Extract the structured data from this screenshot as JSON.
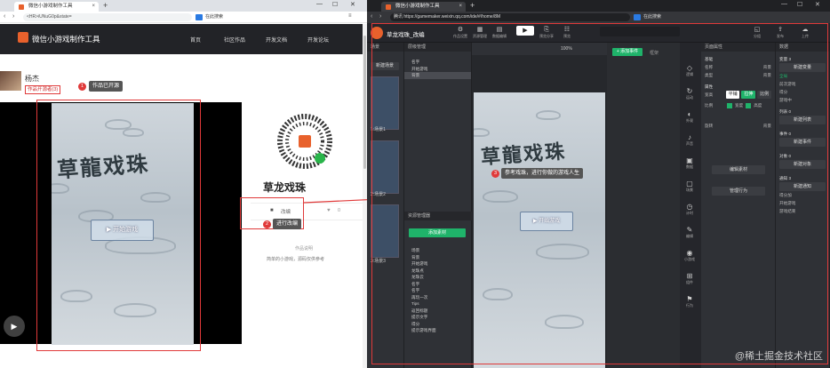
{
  "left_browser": {
    "tab_title": "微信小游戏制作工具",
    "url": "<HR>iUNuG0p&state=",
    "search_text": "在此搜索",
    "site_title": "微信小游戏制作工具",
    "menu": [
      "首页",
      "社区作品",
      "开发文档",
      "开发论坛"
    ],
    "author_name": "杨杰",
    "author_tag": "作品开源者(3)",
    "callout_1": "作品已开源",
    "callout_1_num": "1",
    "game_title": "草龍戏珠",
    "start_label": "▶ 开始游戏",
    "game_name": "草龙戏珠",
    "stat_left": "改编",
    "stat_right": "0",
    "callout_2": "进行改编",
    "callout_2_num": "2",
    "sub_title": "作品说明",
    "sub_desc": "简单的小游戏，源码仅供参考"
  },
  "right_browser": {
    "tab_title": "微信小游戏制作工具",
    "url": "腾讯  https://gamemaker.weixin.qq.com/ide/#/home/8M",
    "search_text": "在此搜索",
    "project_name": "草龙戏珠_改编",
    "toolbar": [
      "作品设置",
      "资源管理",
      "数据编辑",
      "",
      "预览分享",
      "预览",
      "帮助"
    ],
    "toolbar_right": [
      "分组",
      "发布",
      "上传"
    ],
    "left_panel_header": "场景",
    "new_scene": "新建场景",
    "scenes": [
      "1:场景1",
      "2:场景2",
      "3:场景3"
    ],
    "tree_header": "层级管理",
    "tree_items": [
      "名字",
      "开始游戏",
      "背景"
    ],
    "resource_header": "资源管理器",
    "add_resource": "添加素材",
    "resource_items": [
      "场景",
      "背景",
      "开始游戏",
      "龙珠点",
      "龙珠云",
      "名字",
      "名字",
      "再玩一次",
      "Tips",
      "返回标题",
      "提示文字",
      "得分",
      "提示游戏界面"
    ],
    "zoom": "100%",
    "add_event": "+ 添加事件",
    "event_hint": "框架",
    "callout_3": "参考戏珠，进行你做的游戏人生",
    "callout_3_num": "3",
    "side_icons": [
      "逻辑",
      "运动",
      "外观",
      "声音",
      "数据",
      "场景",
      "计时",
      "编辑",
      "小游戏",
      "组件",
      "行为"
    ],
    "props_header": "页面属性",
    "props": [
      "基础",
      "名称",
      "类型",
      "属性",
      "宽高",
      "比例",
      "旋转",
      "位置"
    ],
    "props_values": [
      "背景",
      "背景",
      "背景",
      "背景"
    ],
    "align_btns": [
      "平铺",
      "拉伸",
      "比例"
    ],
    "check_labels": [
      "宽度",
      "高度"
    ],
    "edit_material": "编辑素材",
    "manage_behavior": "管理行为",
    "data_header": "数据",
    "var_title": "变量 3",
    "new_var": "新建变量",
    "var_items": [
      "全局",
      "前次游戏",
      "得分",
      "游戏中"
    ],
    "list_title": "列表 0",
    "new_list": "新建列表",
    "event_title": "事件 0",
    "new_event": "新建事件",
    "obj_title": "对象 0",
    "new_obj": "新建对象",
    "notify_title": "通知 3",
    "new_notify": "新建通知",
    "notify_items": [
      "得分加",
      "开始游戏",
      "游戏结束"
    ]
  },
  "watermark": "@稀土掘金技术社区"
}
